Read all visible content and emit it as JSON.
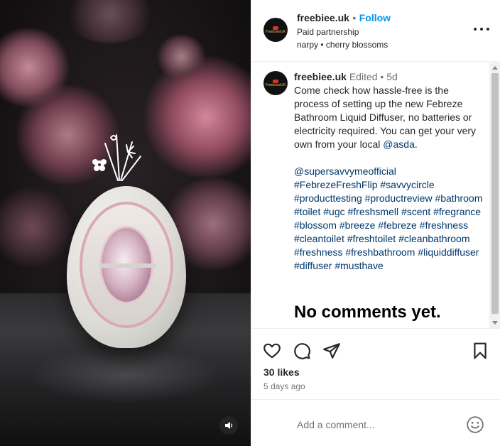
{
  "header": {
    "username": "freebiee.uk",
    "separator": "•",
    "follow_label": "Follow",
    "partnership_label": "Paid partnership",
    "audio_artist": "narpy",
    "audio_separator": "•",
    "audio_track": "cherry blossoms"
  },
  "caption": {
    "username": "freebiee.uk",
    "edited_label": "Edited",
    "separator": "•",
    "age": "5d",
    "text_part1": "Come check how hassle-free is the process of setting up the new Febreze Bathroom Liquid Diffuser, no batteries or electricity required. You can get your very own from your local ",
    "mention_asda": "@asda",
    "text_part1_end": ".",
    "mention_partner": "@supersavvymeofficial",
    "hashtags": [
      "#FebrezeFreshFlip",
      "#savvycircle",
      "#producttesting",
      "#productreview",
      "#bathroom",
      "#toilet",
      "#ugc",
      "#freshsmell",
      "#scent",
      "#fregrance",
      "#blossom",
      "#breeze",
      "#febreze",
      "#freshness",
      "#cleantoilet",
      "#freshtoilet",
      "#cleanbathroom",
      "#freshness",
      "#freshbathroom",
      "#liquiddiffuser",
      "#diffuser",
      "#musthave"
    ]
  },
  "comments": {
    "empty_label": "No comments yet."
  },
  "post": {
    "likes_label": "30 likes",
    "time_ago": "5 days ago"
  },
  "comment_box": {
    "placeholder": "Add a comment..."
  },
  "avatar_text": "FreebieeUK",
  "icons": {
    "like": "heart-icon",
    "comment": "comment-bubble-icon",
    "share": "paper-plane-icon",
    "save": "bookmark-icon",
    "emoji": "smiley-icon",
    "sound": "speaker-icon",
    "more": "more-options-icon"
  },
  "colors": {
    "link": "#0095f6",
    "hashtag": "#00376b",
    "muted": "#737373",
    "text": "#262626"
  }
}
